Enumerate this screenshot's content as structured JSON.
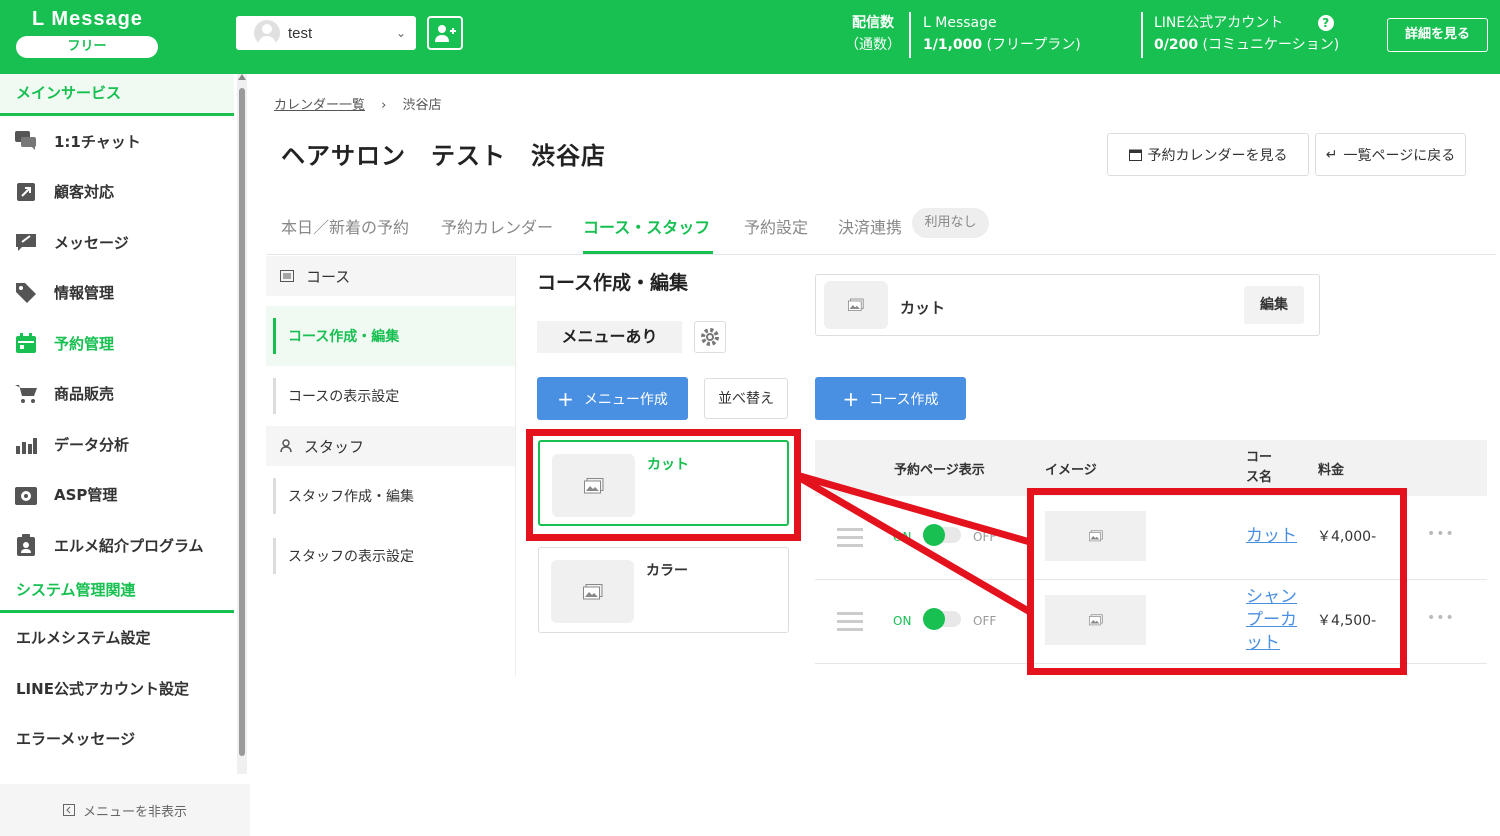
{
  "header": {
    "logo": "L Message",
    "plan": "フリー",
    "account_name": "test",
    "stat1_label": "配信数",
    "stat1_sub": "（通数）",
    "stat2_label": "L Message",
    "stat2_value": "1/1,000",
    "stat2_plan": "(フリープラン)",
    "stat3_label": "LINE公式アカウント",
    "stat3_value": "0/200",
    "stat3_plan": "(コミュニケーション)",
    "detail_button": "詳細を見る"
  },
  "sidebar": {
    "section_main": "メインサービス",
    "items": [
      {
        "label": "1:1チャット",
        "icon": "chat-icon"
      },
      {
        "label": "顧客対応",
        "icon": "arrow-box-icon"
      },
      {
        "label": "メッセージ",
        "icon": "message-icon"
      },
      {
        "label": "情報管理",
        "icon": "tag-icon"
      },
      {
        "label": "予約管理",
        "icon": "calendar-icon"
      },
      {
        "label": "商品販売",
        "icon": "cart-icon"
      },
      {
        "label": "データ分析",
        "icon": "chart-icon"
      },
      {
        "label": "ASP管理",
        "icon": "asp-icon"
      },
      {
        "label": "エルメ紹介プログラム",
        "icon": "clipboard-icon"
      }
    ],
    "section_system": "システム管理関連",
    "system_items": [
      "エルメシステム設定",
      "LINE公式アカウント設定",
      "エラーメッセージ"
    ],
    "hide_menu": "メニューを非表示"
  },
  "breadcrumb": {
    "link": "カレンダー一覧",
    "current": "渋谷店"
  },
  "page_title": "ヘアサロン　テスト　渋谷店",
  "buttons": {
    "view_calendar": "予約カレンダーを見る",
    "back_list": "一覧ページに戻る"
  },
  "tabs": [
    "本日／新着の予約",
    "予約カレンダー",
    "コース・スタッフ",
    "予約設定",
    "決済連携"
  ],
  "tab_badge": "利用なし",
  "subnav": {
    "course_head": "コース",
    "course_items": [
      "コース作成・編集",
      "コースの表示設定"
    ],
    "staff_head": "スタッフ",
    "staff_items": [
      "スタッフ作成・編集",
      "スタッフの表示設定"
    ]
  },
  "middle": {
    "title": "コース作成・編集",
    "menu_chip": "メニューあり",
    "create_menu": "メニュー作成",
    "sort": "並べ替え",
    "menus": [
      "カット",
      "カラー"
    ]
  },
  "right": {
    "selected_menu": "カット",
    "edit": "編集",
    "create_course": "コース作成",
    "columns": [
      "予約ページ表示",
      "イメージ",
      "コース名",
      "料金"
    ],
    "on_label": "ON",
    "off_label": "OFF",
    "rows": [
      {
        "name": "カット",
        "price": "￥4,000-"
      },
      {
        "name": "シャンプーカット",
        "price": "￥4,500-"
      }
    ]
  },
  "colors": {
    "brand": "#17c051",
    "accent_blue": "#4a90e2",
    "annotation": "#e3121d"
  }
}
